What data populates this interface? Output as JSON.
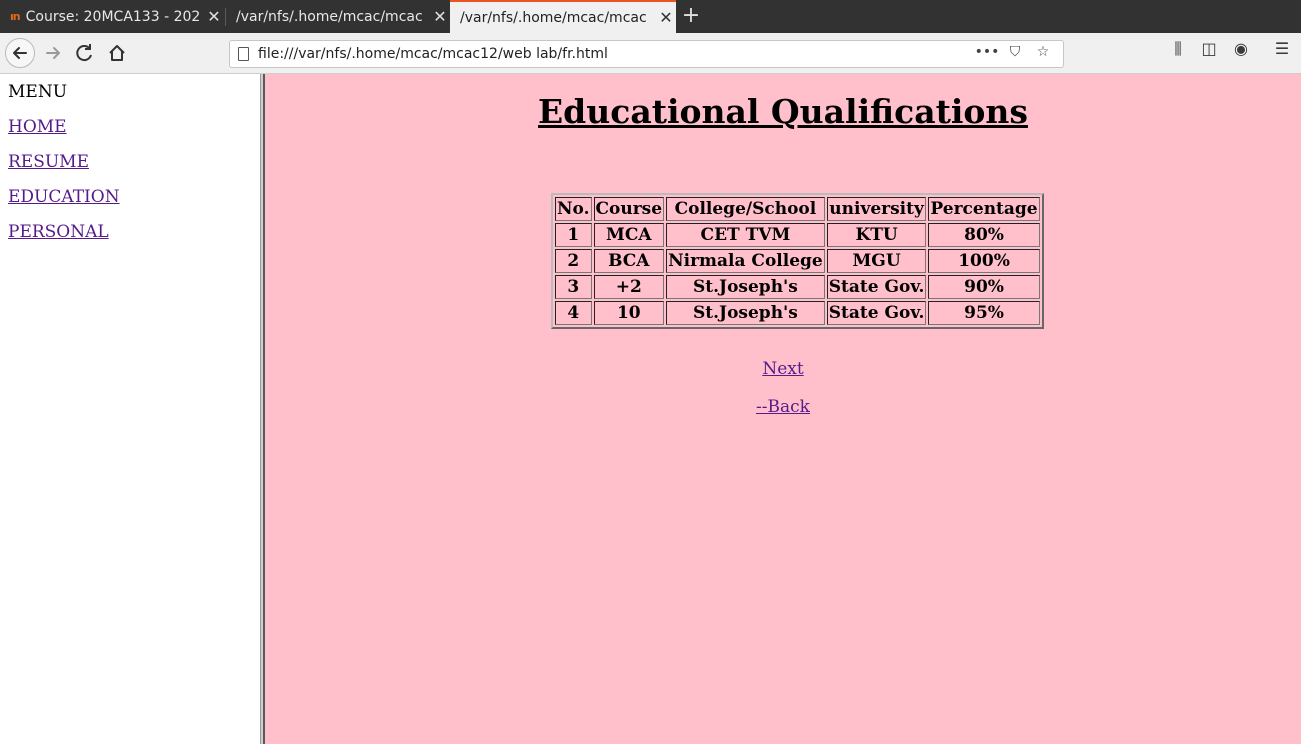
{
  "browser": {
    "tabs": [
      {
        "label": "Course: 20MCA133 - 202",
        "favicon": "moodle-icon"
      },
      {
        "label": "/var/nfs/.home/mcac/mcac"
      },
      {
        "label": "/var/nfs/.home/mcac/mcac",
        "active": true
      }
    ],
    "url": "file:///var/nfs/.home/mcac/mcac12/web lab/fr.html",
    "accent_color": "#e95420"
  },
  "menu": {
    "title": "MENU",
    "links": [
      "HOME",
      "RESUME",
      "EDUCATION",
      "PERSONAL"
    ]
  },
  "main": {
    "heading": "Educational Qualifications",
    "background": "#ffc0cb",
    "table": {
      "headers": [
        "No.",
        "Course",
        "College/School",
        "university",
        "Percentage"
      ],
      "rows": [
        [
          "1",
          "MCA",
          "CET TVM",
          "KTU",
          "80%"
        ],
        [
          "2",
          "BCA",
          "Nirmala College",
          "MGU",
          "100%"
        ],
        [
          "3",
          "+2",
          "St.Joseph's",
          "State Gov.",
          "90%"
        ],
        [
          "4",
          "10",
          "St.Joseph's",
          "State Gov.",
          "95%"
        ]
      ]
    },
    "next_link": "Next",
    "back_link": "--Back"
  }
}
